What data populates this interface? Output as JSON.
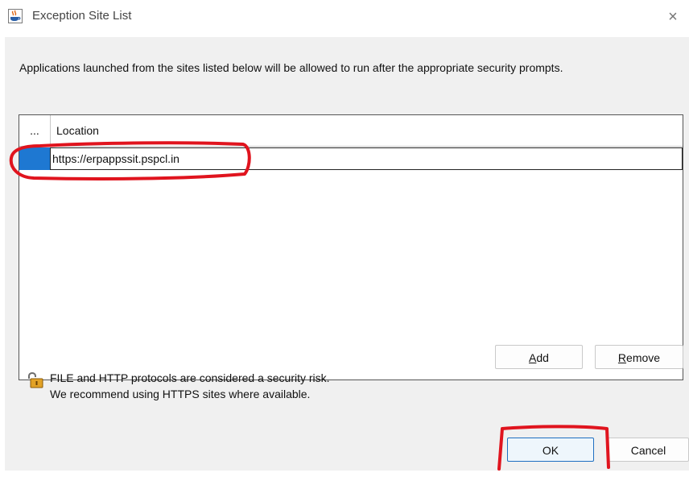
{
  "window": {
    "title": "Exception Site List",
    "close_glyph": "×",
    "icon": "java-cup-icon"
  },
  "description": "Applications launched from the sites listed below will be allowed to run after the appropriate security prompts.",
  "table": {
    "columns": [
      "...",
      "Location"
    ],
    "rows": [
      {
        "location": "https://erpappssit.pspcl.in",
        "selected": true
      }
    ]
  },
  "buttons": {
    "add_prefix": "",
    "add_mnemonic": "A",
    "add_suffix": "dd",
    "remove_prefix": "",
    "remove_mnemonic": "R",
    "remove_suffix": "emove",
    "ok": "OK",
    "cancel": "Cancel"
  },
  "warning": {
    "icon": "padlock-warning-icon",
    "line1": "FILE and HTTP protocols are considered a security risk.",
    "line2": "We recommend using HTTPS sites where available."
  },
  "colors": {
    "selection": "#1e78d2",
    "annotation": "#e0141e",
    "ok_border": "#1f6fc1"
  }
}
